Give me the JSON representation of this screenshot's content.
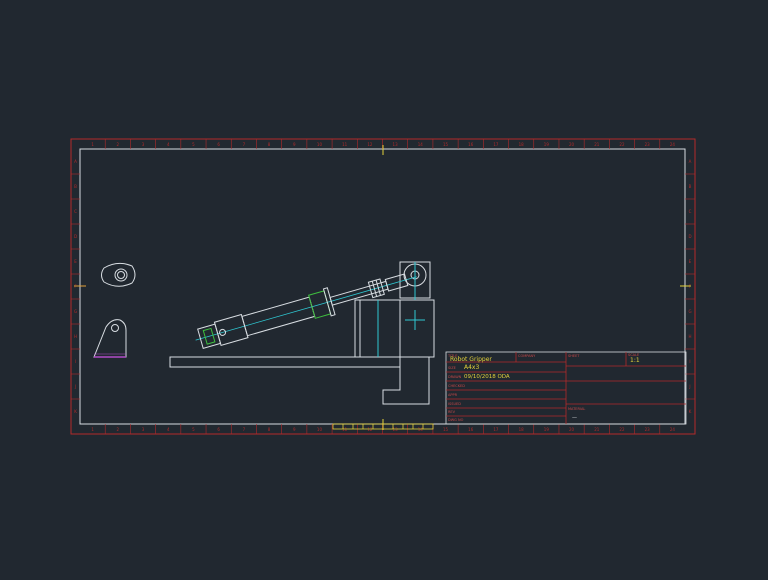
{
  "colors": {
    "background": "#212830",
    "frame_red": "#b22a2a",
    "geometry_white": "#d8dde2",
    "centerline_cyan": "#2fc8d2",
    "highlight_green": "#3fbf3f",
    "text_yellow": "#e3d23a",
    "label_red": "#c84848",
    "magenta": "#b24cc8"
  },
  "frame": {
    "col_numbers": [
      "1",
      "2",
      "3",
      "4",
      "5",
      "6",
      "7",
      "8",
      "9",
      "10",
      "11",
      "12",
      "13",
      "14",
      "15",
      "16",
      "17",
      "18",
      "19",
      "20",
      "21",
      "22",
      "23",
      "24"
    ],
    "row_letters": [
      "A",
      "B",
      "C",
      "D",
      "E",
      "F",
      "G",
      "H",
      "I",
      "J",
      "K"
    ]
  },
  "title_block": {
    "title_label": "TITLE",
    "title_value": "Robot Gripper",
    "size_label": "SIZE",
    "size_value": "A4x3",
    "drawn_label": "DRAWN",
    "drawn_value": "09/10/2018 ODA",
    "checked_label": "CHECKED",
    "appr_label": "APPR",
    "issued_label": "ISSUED",
    "rev_label": "REV",
    "dwg_label": "DWG NO",
    "scale_label": "SCALE",
    "scale_value": "1:1",
    "sheet_label": "SHEET",
    "material_label": "MATERIAL",
    "material_value": "—",
    "company_label": "COMPANY"
  }
}
